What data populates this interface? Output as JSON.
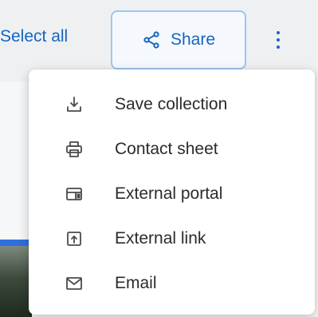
{
  "toolbar": {
    "select_all_label": "Select all",
    "share_label": "Share",
    "share_icon": "share-icon",
    "more_icon": "more-vertical-icon"
  },
  "menu": {
    "items": [
      {
        "label": "Save collection",
        "icon": "download-icon"
      },
      {
        "label": "Contact sheet",
        "icon": "printer-icon"
      },
      {
        "label": "External portal",
        "icon": "portal-icon"
      },
      {
        "label": "External link",
        "icon": "external-link-icon"
      },
      {
        "label": "Email",
        "icon": "mail-icon"
      }
    ]
  },
  "colors": {
    "accent": "#1565c0",
    "button_border": "#9ec6ee",
    "text": "#2b2b2b",
    "icon": "#4a4a4a"
  }
}
